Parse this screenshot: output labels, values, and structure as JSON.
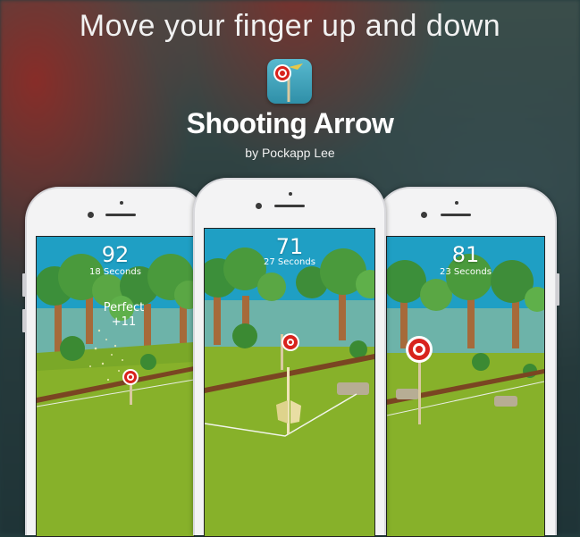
{
  "headline": "Move your finger up and down",
  "app": {
    "title": "Shooting Arrow",
    "author": "by Pockapp Lee",
    "icon": "archery-target-icon"
  },
  "phones": [
    {
      "score": "92",
      "seconds": "18 Seconds",
      "feedback": "Perfect",
      "bonus": "+11"
    },
    {
      "score": "71",
      "seconds": "27 Seconds"
    },
    {
      "score": "81",
      "seconds": "23 Seconds"
    }
  ],
  "colors": {
    "sky": "#1f9fc4",
    "grass": "#87b12a",
    "target_red": "#d8231d",
    "phone_body": "#f3f3f4"
  }
}
